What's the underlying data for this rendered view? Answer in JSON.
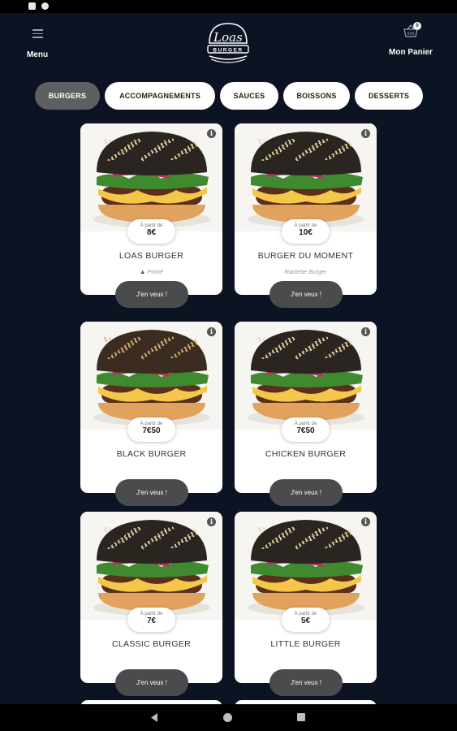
{
  "header": {
    "menu_label": "Menu",
    "cart_label": "Mon Panier",
    "cart_count": "0",
    "logo_text": "Loas",
    "logo_subtext": "BURGER"
  },
  "tabs": [
    {
      "label": "BURGERS",
      "active": true
    },
    {
      "label": "ACCOMPAGNEMENTS",
      "active": false
    },
    {
      "label": "SAUCES",
      "active": false
    },
    {
      "label": "BOISSONS",
      "active": false
    },
    {
      "label": "DESSERTS",
      "active": false
    }
  ],
  "products": [
    {
      "name": "LOAS BURGER",
      "price_prefix": "À partir de",
      "price": "8€",
      "tagline": "Primé",
      "cta": "J'en veux !",
      "bun": "black"
    },
    {
      "name": "BURGER DU MOMENT",
      "price_prefix": "À partir de",
      "price": "10€",
      "tagline": "Raclette Burger",
      "cta": "J'en veux !",
      "bun": "black"
    },
    {
      "name": "BLACK BURGER",
      "price_prefix": "À partir de",
      "price": "7€50",
      "tagline": "",
      "cta": "J'en veux !",
      "bun": "sesame"
    },
    {
      "name": "CHICKEN BURGER",
      "price_prefix": "À partir de",
      "price": "7€50",
      "tagline": "",
      "cta": "J'en veux !",
      "bun": "black"
    },
    {
      "name": "CLASSIC BURGER",
      "price_prefix": "À partir de",
      "price": "7€",
      "tagline": "",
      "cta": "J'en veux !",
      "bun": "black"
    },
    {
      "name": "LITTLE BURGER",
      "price_prefix": "À partir de",
      "price": "5€",
      "tagline": "",
      "cta": "J'en veux !",
      "bun": "black"
    }
  ],
  "colors": {
    "background": "#0c1322",
    "tab_active": "#5d5f63",
    "cta": "#4a4b4d"
  }
}
